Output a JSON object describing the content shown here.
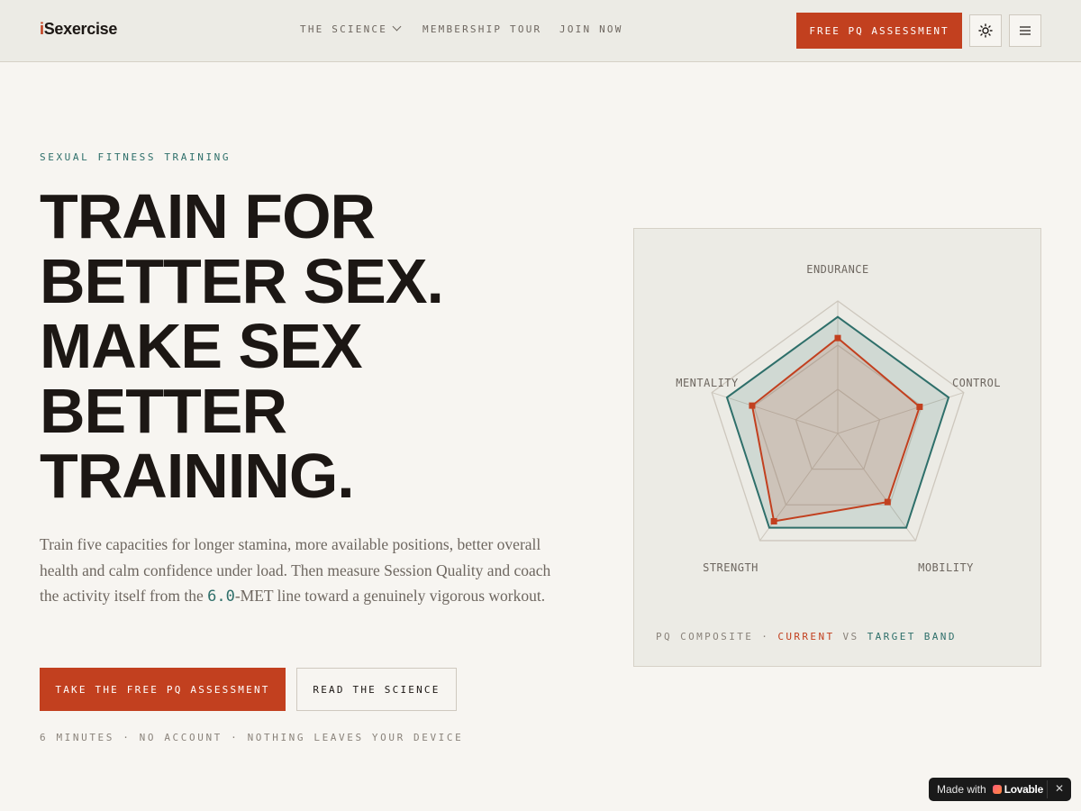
{
  "brand": {
    "logo_i": "i",
    "logo_rest": "Sexercise"
  },
  "nav": {
    "science": "THE SCIENCE",
    "tour": "MEMBERSHIP TOUR",
    "join": "JOIN NOW",
    "cta": "FREE PQ ASSESSMENT"
  },
  "hero": {
    "eyebrow": "SEXUAL FITNESS TRAINING",
    "headline": [
      "TRAIN FOR",
      "BETTER SEX.",
      "MAKE SEX",
      "BETTER",
      "TRAINING."
    ],
    "lede_before": "Train five capacities for longer stamina, more available positions, better overall health and calm confidence under load. Then measure Session Quality and coach the activity itself from the ",
    "lede_met": "6.0",
    "lede_after": "-MET line toward a genuinely vigorous workout.",
    "primary_cta": "TAKE THE FREE PQ ASSESSMENT",
    "secondary_cta": "READ THE SCIENCE",
    "fineprint": "6 MINUTES · NO ACCOUNT · NOTHING LEAVES YOUR DEVICE"
  },
  "radar": {
    "legend_prefix": "PQ COMPOSITE · ",
    "legend_current": "CURRENT",
    "legend_vs": " VS ",
    "legend_target": "TARGET BAND"
  },
  "chart_data": {
    "type": "radar",
    "axes": [
      "ENDURANCE",
      "CONTROL",
      "MOBILITY",
      "STRENGTH",
      "MENTALITY"
    ],
    "range": [
      0,
      100
    ],
    "rings": 3,
    "series": [
      {
        "name": "TARGET BAND",
        "values": [
          88,
          88,
          88,
          88,
          88
        ],
        "color": "#2e6f6a"
      },
      {
        "name": "CURRENT",
        "values": [
          72,
          65,
          64,
          82,
          68
        ],
        "color": "#c2401f"
      }
    ]
  },
  "badge": {
    "made_with": "Made with",
    "brand": "Lovable",
    "close": "✕"
  },
  "colors": {
    "accent": "#c2401f",
    "teal": "#2e6f6a",
    "bg": "#f7f5f1"
  }
}
